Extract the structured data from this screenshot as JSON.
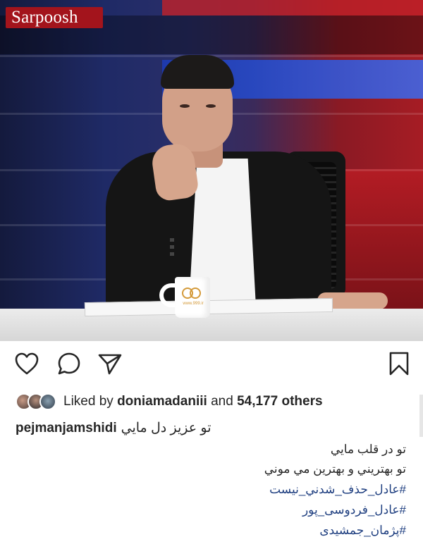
{
  "watermark": {
    "text": "Sarpoosh"
  },
  "mug": {
    "text": "www.999.ir"
  },
  "actions": {
    "like": "heart-icon",
    "comment": "comment-icon",
    "share": "send-icon",
    "save": "bookmark-icon"
  },
  "likes": {
    "prefix": "Liked by",
    "user": "doniamadaniii",
    "middle": "and",
    "count": "54,177 others"
  },
  "caption": {
    "username": "pejmanjamshidi",
    "first_line": "تو عزيز دل مايي",
    "lines": [
      "تو در قلب مايي",
      "تو بهتريني و بهترين مي موني"
    ],
    "hashtags": [
      "#عادل_حذف_شدني_نيست",
      "#عادل_فردوسی_پور",
      "#پژمان_جمشیدی"
    ]
  },
  "colors": {
    "hashtag": "#1f3f80",
    "text": "#262626",
    "watermark_bg": "#a3141c"
  }
}
